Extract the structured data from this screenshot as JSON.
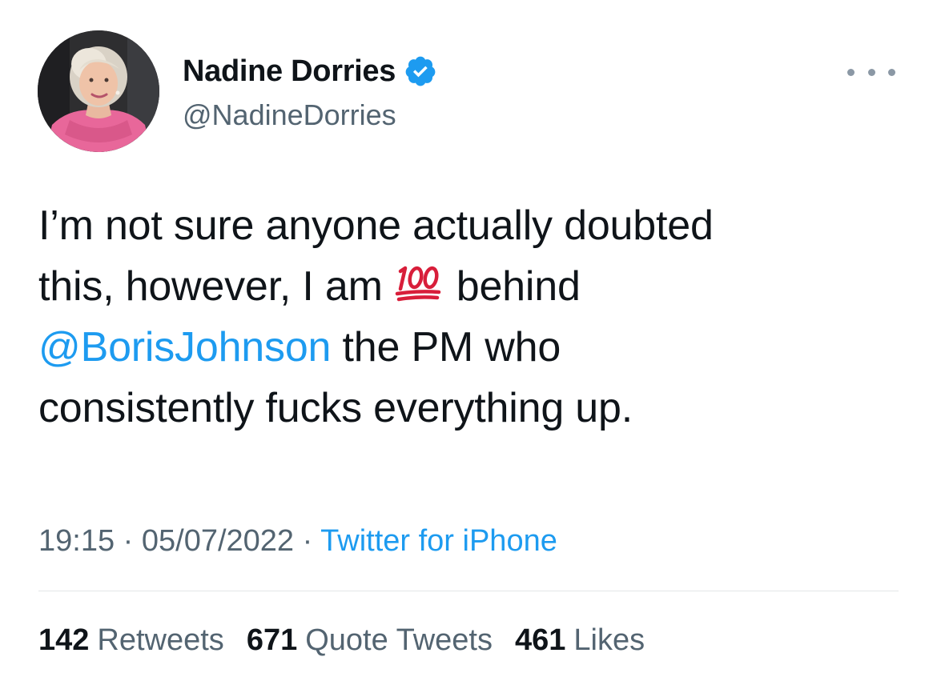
{
  "author": {
    "name": "Nadine Dorries",
    "handle": "@NadineDorries",
    "verified_icon": "verified-badge-icon",
    "verified_color": "#1d9bf0"
  },
  "tweet": {
    "lines": [
      [
        "I’m not sure anyone actually doubted"
      ],
      [
        "this, however, I am",
        "behind"
      ],
      [
        "@BorisJohnson",
        "the PM who"
      ],
      [
        "consistently fucks everything up."
      ]
    ],
    "emoji": "hundred-points-icon",
    "mention": "@BorisJohnson"
  },
  "meta": {
    "time": "19:15",
    "date": "05/07/2022",
    "separator": "·",
    "source": "Twitter for iPhone"
  },
  "stats": {
    "retweets_count": "142",
    "retweets_label": "Retweets",
    "quotes_count": "671",
    "quotes_label": "Quote Tweets",
    "likes_count": "461",
    "likes_label": "Likes"
  },
  "colors": {
    "link": "#1d9bf0",
    "secondary_text": "#536471",
    "primary_text": "#0f1419"
  }
}
